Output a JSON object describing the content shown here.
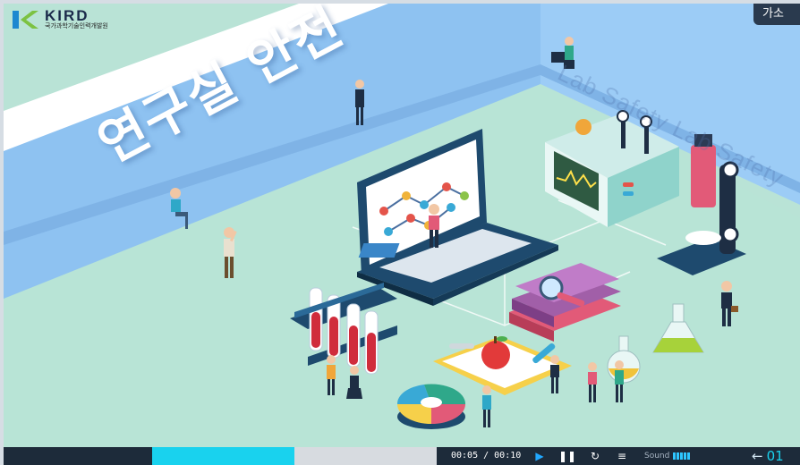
{
  "header": {
    "logo_text": "KIRD",
    "logo_org": "국가과학기술인력개발원",
    "corner_button_label": "가소"
  },
  "scene": {
    "title": "연구실 안전",
    "wall_text": "Lab Safety Lab Safety"
  },
  "player": {
    "time_display": "00:05 / 00:10",
    "progress_fraction": 0.5,
    "sound_label": "Sound",
    "sound_level_bars": 5,
    "page_number": "01",
    "colors": {
      "bar": "#1d2b3a",
      "progress": "#19d2ee",
      "accent": "#21a8ff"
    }
  }
}
